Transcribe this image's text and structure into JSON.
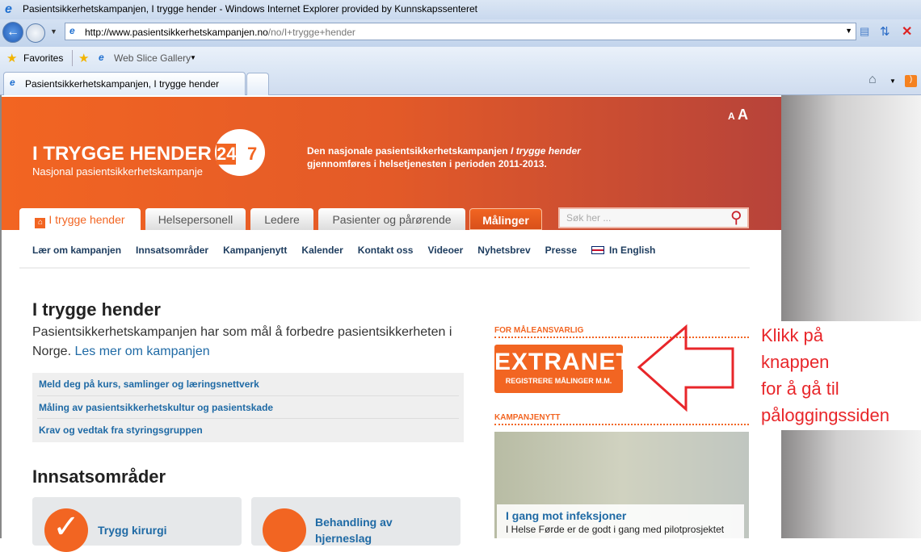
{
  "browser": {
    "window_title": "Pasientsikkerhetskampanjen, I trygge hender - Windows Internet Explorer provided by Kunnskapssenteret",
    "url_domain": "http://www.pasientsikkerhetskampanjen.no",
    "url_path": "/no/I+trygge+hender",
    "favorites_label": "Favorites",
    "web_slice_label": "Web Slice Gallery",
    "tab_title": "Pasientsikkerhetskampanjen, I trygge hender"
  },
  "header": {
    "font_small": "A",
    "font_large": "A",
    "logo_title": "I TRYGGE HENDER",
    "logo_badge_left": "24",
    "logo_badge_right": "7",
    "logo_subtitle": "Nasjonal pasientsikkerhetskampanje",
    "tagline_1": "Den nasjonale pasientsikkerhetskampanjen ",
    "tagline_italic": "I trygge hender",
    "tagline_2": "gjennomføres i helsetjenesten i perioden 2011-2013.",
    "search_placeholder": "Søk her ..."
  },
  "main_tabs": [
    "I trygge hender",
    "Helsepersonell",
    "Ledere",
    "Pasienter og pårørende",
    "Målinger"
  ],
  "sub_nav": [
    "Lær om kampanjen",
    "Innsatsområder",
    "Kampanjenytt",
    "Kalender",
    "Kontakt oss",
    "Videoer",
    "Nyhetsbrev",
    "Presse",
    "In English"
  ],
  "content": {
    "title": "I trygge hender",
    "intro": "Pasientsikkerhetskampanjen har som mål å forbedre pasientsikkerheten i Norge. ",
    "intro_link": "Les mer om kampanjen",
    "links": [
      "Meld deg på kurs, samlinger og læringsnettverk",
      "Måling av pasientsikkerhetskultur og pasientskade",
      "Krav og vedtak fra styringsgruppen"
    ],
    "section_title": "Innsatsområder",
    "cards": [
      "Trygg kirurgi",
      "Behandling av hjerneslag"
    ]
  },
  "sidebar": {
    "extranet_heading": "FOR MÅLEANSVARLIG",
    "extranet_logo": "EXTRANET",
    "extranet_sub": "REGISTRERE MÅLINGER M.M.",
    "news_heading": "KAMPANJENYTT",
    "news_title": "I gang mot infeksjoner",
    "news_text": "I Helse Førde er de godt i gang med pilotprosjektet"
  },
  "annotation": {
    "lines": [
      "Klikk på",
      "knappen",
      "for å gå til",
      "påloggingssiden"
    ],
    "color": "#e8262a"
  },
  "colors": {
    "brand_orange": "#f26522",
    "link_blue": "#1f6aa5"
  }
}
